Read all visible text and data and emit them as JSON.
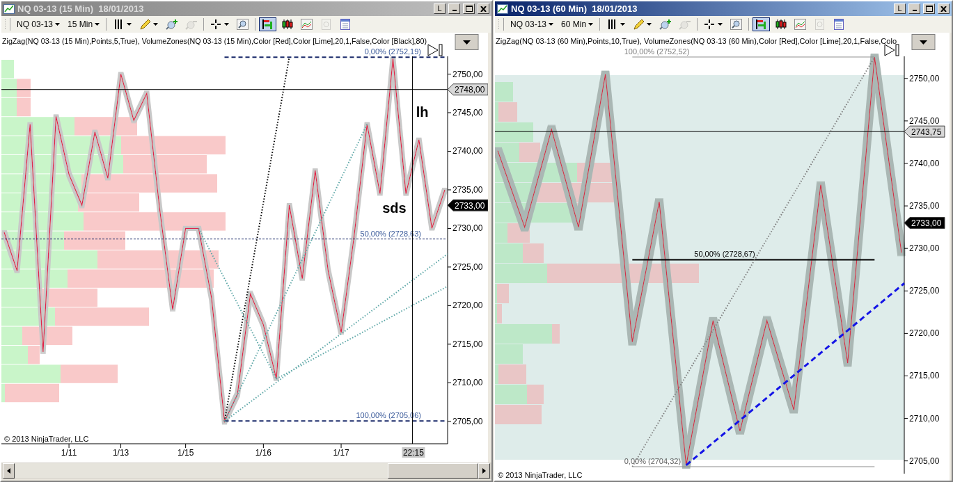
{
  "windows": [
    {
      "title": "NQ 03-13 (15 Min)  18/01/2013",
      "active": false,
      "link_label": "L",
      "toolbar": {
        "instrument": "NQ 03-13",
        "interval": "15 Min",
        "tools": [
          {
            "kind": "bar-style",
            "selected": false,
            "disabled": false
          },
          {
            "kind": "pencil",
            "selected": false,
            "disabled": false
          },
          {
            "kind": "zoom-in",
            "selected": false,
            "disabled": false
          },
          {
            "kind": "zoom-out",
            "selected": false,
            "disabled": true
          },
          {
            "kind": "crosshair",
            "selected": false,
            "disabled": false
          },
          {
            "kind": "zoom-box",
            "selected": false,
            "disabled": false
          },
          {
            "kind": "data-series",
            "selected": true,
            "disabled": false
          },
          {
            "kind": "candles",
            "selected": false,
            "disabled": false
          },
          {
            "kind": "indicators",
            "selected": false,
            "disabled": false
          },
          {
            "kind": "page",
            "selected": false,
            "disabled": true
          },
          {
            "kind": "properties",
            "selected": false,
            "disabled": false
          }
        ]
      },
      "indicator_label": "ZigZag(NQ 03-13 (15 Min),Points,5,True), VolumeZones(NQ 03-13 (15 Min),Color [Red],Color [Lime],20,1,False,Color [Black],80)",
      "fib_labels": [
        "0,00% (2752,19)",
        "50,00% (2728,63)",
        "100,00% (2705,06)"
      ],
      "notes": [
        "lh",
        "sds"
      ],
      "price_tags": [
        {
          "text": "2748,00",
          "last": false
        },
        {
          "text": "2733,00",
          "last": true
        }
      ],
      "crosshair_time": "22:15",
      "copyright": "© 2013 NinjaTrader, LLC",
      "chart_data": {
        "type": "line",
        "ylim": [
          2702.1,
          2752.3
        ],
        "categories": [
          null,
          null,
          null,
          null,
          null,
          "1/11",
          null,
          null,
          null,
          "1/13",
          null,
          null,
          null,
          null,
          "1/15",
          null,
          null,
          null,
          null,
          null,
          "1/16",
          null,
          null,
          null,
          null,
          null,
          "1/17",
          null,
          null,
          null,
          null,
          null,
          null,
          null,
          null
        ],
        "series": [
          {
            "color": "#e0204a",
            "values": [
              2729.5,
              2724.5,
              2743.5,
              2714,
              2744.5,
              2737,
              2733,
              2742.5,
              2736.5,
              2750,
              2744,
              2747.5,
              2732.5,
              2719.5,
              2730,
              2730,
              2721,
              2705,
              2708.5,
              2721.5,
              2717.5,
              2710.5,
              2733,
              2723.5,
              2737.5,
              2724.5,
              2716.5,
              2729,
              2743.5,
              2734.5,
              2752,
              2734.5,
              2741.5,
              2730,
              2735
            ]
          }
        ],
        "yticks": [
          {
            "value": 2705,
            "label": "2705,00"
          },
          {
            "value": 2710,
            "label": "2710,00"
          },
          {
            "value": 2715,
            "label": "2715,00"
          },
          {
            "value": 2720,
            "label": "2720,00"
          },
          {
            "value": 2725,
            "label": "2725,00"
          },
          {
            "value": 2730,
            "label": "2730,00"
          },
          {
            "value": 2735,
            "label": "2735,00"
          },
          {
            "value": 2740,
            "label": "2740,00"
          },
          {
            "value": 2745,
            "label": "2745,00"
          },
          {
            "value": 2750,
            "label": "2750,00"
          }
        ]
      }
    },
    {
      "title": "NQ 03-13 (60 Min)  18/01/2013",
      "active": true,
      "link_label": "L",
      "toolbar": {
        "instrument": "NQ 03-13",
        "interval": "60 Min",
        "tools": [
          {
            "kind": "bar-style",
            "selected": false,
            "disabled": false
          },
          {
            "kind": "pencil",
            "selected": false,
            "disabled": false
          },
          {
            "kind": "zoom-in",
            "selected": false,
            "disabled": false
          },
          {
            "kind": "zoom-out",
            "selected": false,
            "disabled": true
          },
          {
            "kind": "crosshair",
            "selected": false,
            "disabled": false
          },
          {
            "kind": "zoom-box",
            "selected": false,
            "disabled": false
          },
          {
            "kind": "data-series",
            "selected": true,
            "disabled": false
          },
          {
            "kind": "candles",
            "selected": false,
            "disabled": false
          },
          {
            "kind": "indicators",
            "selected": false,
            "disabled": false
          },
          {
            "kind": "page",
            "selected": false,
            "disabled": true
          },
          {
            "kind": "properties",
            "selected": false,
            "disabled": false
          }
        ]
      },
      "indicator_label": "ZigZag(NQ 03-13 (60 Min),Points,10,True), VolumeZones(NQ 03-13 (60 Min),Color [Red],Color [Lime],20,1,False,Colo",
      "fib_labels": [
        "100,00% (2752,52)",
        "50,00% (2728,67)",
        "0,00% (2704,32)"
      ],
      "price_tags": [
        {
          "text": "2743,75",
          "last": false
        },
        {
          "text": "2733,00",
          "last": true
        }
      ],
      "copyright": "© 2013 NinjaTrader, LLC",
      "chart_data": {
        "type": "line",
        "ylim": [
          2703.5,
          2752.6
        ],
        "categories": [
          null,
          null,
          null,
          null,
          null,
          null,
          null,
          null,
          null,
          null,
          null,
          null,
          null,
          null,
          null,
          null
        ],
        "series": [
          {
            "color": "#d0304a",
            "values": [
              2741.5,
              2732.5,
              2744,
              2732.5,
              2750.5,
              2719,
              2735.5,
              2704.5,
              2721.5,
              2708.5,
              2721.5,
              2711,
              2737.5,
              2716.5,
              2752.5,
              2729.5
            ]
          }
        ],
        "yticks": [
          {
            "value": 2705,
            "label": "2705,00"
          },
          {
            "value": 2710,
            "label": "2710,00"
          },
          {
            "value": 2715,
            "label": "2715,00"
          },
          {
            "value": 2720,
            "label": "2720,00"
          },
          {
            "value": 2725,
            "label": "2725,00"
          },
          {
            "value": 2730,
            "label": "2730,00"
          },
          {
            "value": 2735,
            "label": "2735,00"
          },
          {
            "value": 2740,
            "label": "2740,00"
          },
          {
            "value": 2745,
            "label": "2745,00"
          },
          {
            "value": 2750,
            "label": "2750,00"
          }
        ]
      }
    }
  ]
}
